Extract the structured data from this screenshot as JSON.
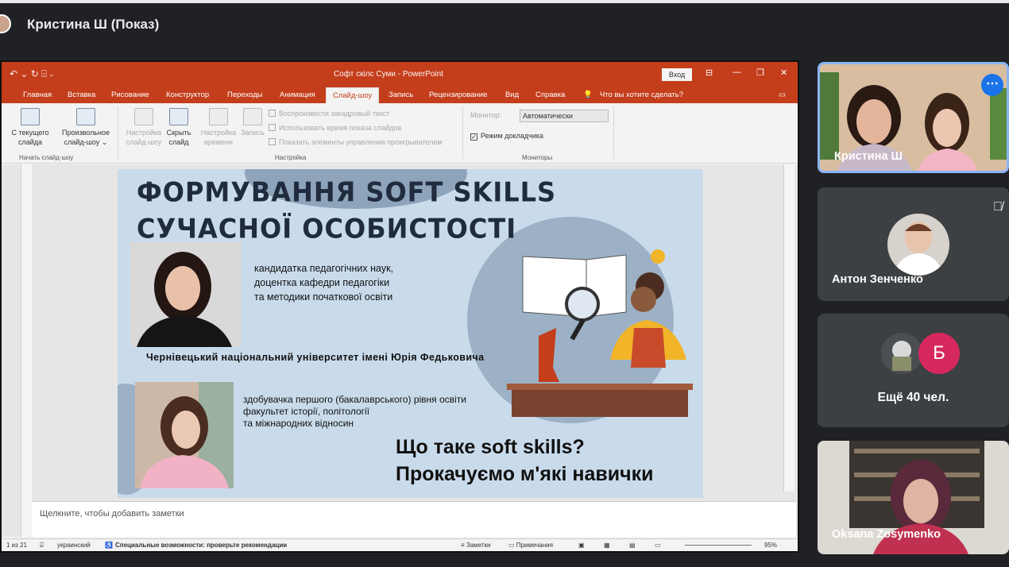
{
  "meeting": {
    "presenter_label": "Кристина Ш (Показ)"
  },
  "ppt": {
    "title": "Софт скілс Суми  -  PowerPoint",
    "login": "Вход",
    "tabs": [
      "Главная",
      "Вставка",
      "Рисование",
      "Конструктор",
      "Переходы",
      "Анимация",
      "Слайд-шоу",
      "Запись",
      "Рецензирование",
      "Вид",
      "Справка"
    ],
    "tell_me": "Что вы хотите сделать?",
    "ribbon": {
      "from_current": "С текущего слайда",
      "custom": "Произвольное слайд-шоу",
      "group_start": "Начать слайд-шоу",
      "setup": "Настройка слайд-шоу",
      "hide": "Скрыть слайд",
      "rehearse": "Настройка времени",
      "record": "Запись",
      "chk1": "Воспроизвести закадровый текст",
      "chk2": "Использовать время показа слайдов",
      "chk3": "Показать элементы управления проигрывателем",
      "group_setup": "Настройка",
      "monitor_label": "Монитор:",
      "monitor_value": "Автоматически",
      "presenter_view": "Режим докладчика",
      "group_monitors": "Мониторы"
    },
    "notes_placeholder": "Щелкните, чтобы добавить заметки",
    "status": {
      "slide": "1 из 21",
      "lang": "украинский",
      "access": "Специальные возможности: проверьте рекомендации",
      "notes": "Заметки",
      "comments": "Примечания",
      "zoom": "95%"
    }
  },
  "slide": {
    "title1": "ФОРМУВАННЯ SOFT SKILLS",
    "title2": "СУЧАСНОЇ ОСОБИСТОСТІ",
    "person1": [
      "кандидатка педагогічних наук,",
      "доцентка кафедри педагогіки",
      "та методики початкової освіти"
    ],
    "university": "Чернівецький національний університет імені Юрія Федьковича",
    "person2": [
      "здобувачка першого (бакалаврського) рівня освіти",
      "факультет історії, політології",
      "та міжнародних відносин"
    ],
    "q1": "Що таке soft skills?",
    "q2": "Прокачуємо м'які навички"
  },
  "participants": {
    "p1": "Кристина Ш",
    "p2": "Антон Зенченко",
    "more_avatar": "Б",
    "more": "Ещё 40 чел.",
    "p4": "Oksana Zosymenko"
  },
  "colors": {
    "ppt_accent": "#c43e1c",
    "meet_bg": "#202124",
    "tile": "#3c4043"
  }
}
